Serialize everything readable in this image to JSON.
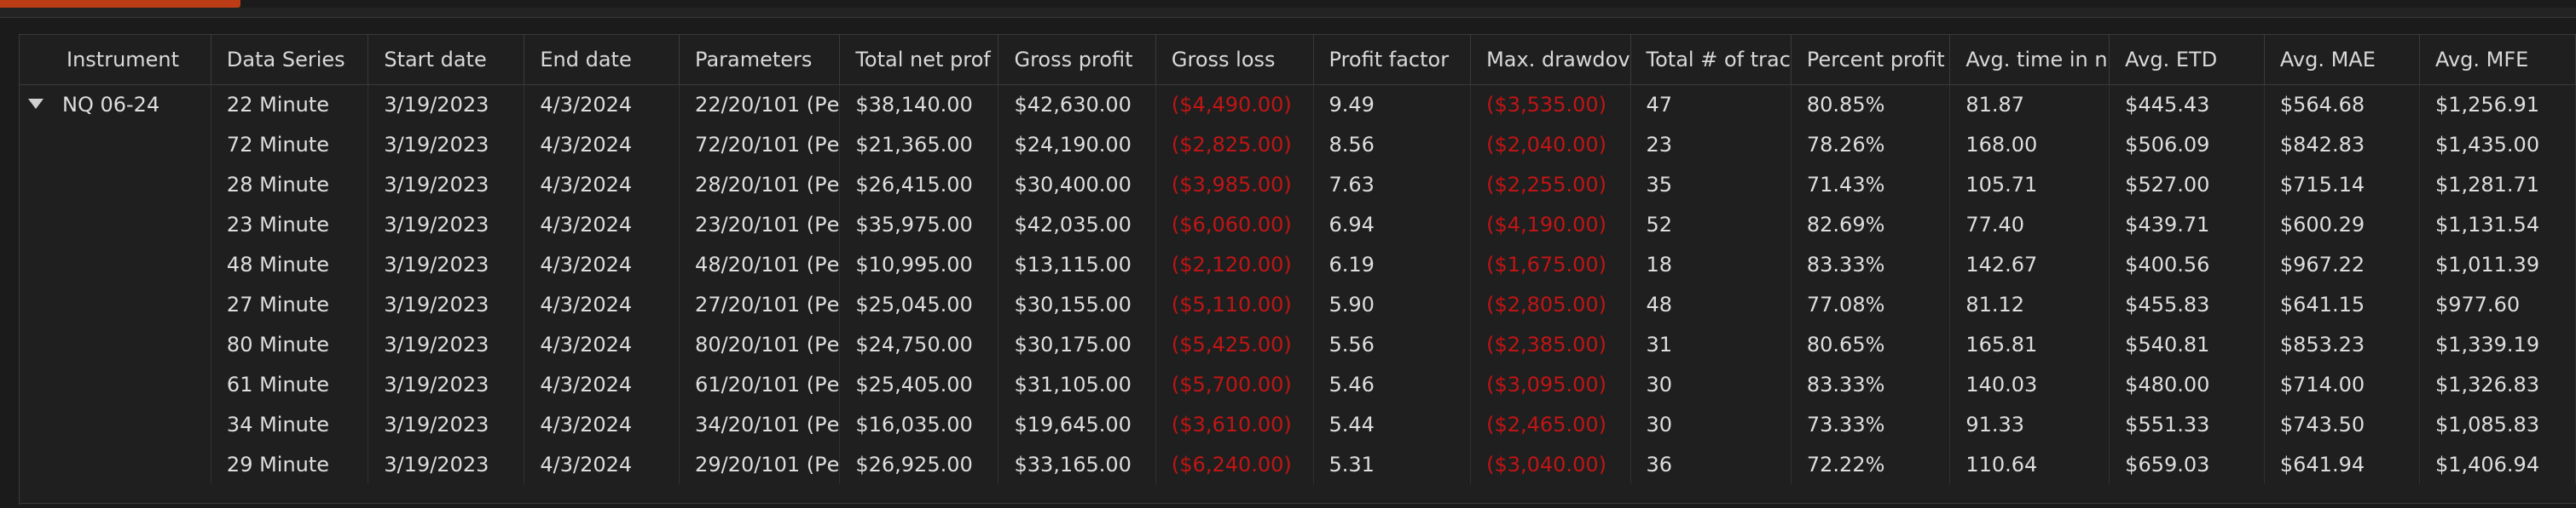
{
  "grid": {
    "columns": [
      "Instrument",
      "Data Series",
      "Start date",
      "End date",
      "Parameters",
      "Total net prof",
      "Gross profit",
      "Gross loss",
      "Profit factor",
      "Max. drawdov",
      "Total # of trac",
      "Percent profit",
      "Avg. time in n",
      "Avg. ETD",
      "Avg. MAE",
      "Avg. MFE"
    ],
    "instrument": "NQ 06-24",
    "rows": [
      [
        "22 Minute",
        "3/19/2023",
        "4/3/2024",
        "22/20/101 (Pе",
        "$38,140.00",
        "$42,630.00",
        "($4,490.00)",
        "9.49",
        "($3,535.00)",
        "47",
        "80.85%",
        "81.87",
        "$445.43",
        "$564.68",
        "$1,256.91"
      ],
      [
        "72 Minute",
        "3/19/2023",
        "4/3/2024",
        "72/20/101 (Pе",
        "$21,365.00",
        "$24,190.00",
        "($2,825.00)",
        "8.56",
        "($2,040.00)",
        "23",
        "78.26%",
        "168.00",
        "$506.09",
        "$842.83",
        "$1,435.00"
      ],
      [
        "28 Minute",
        "3/19/2023",
        "4/3/2024",
        "28/20/101 (Pе",
        "$26,415.00",
        "$30,400.00",
        "($3,985.00)",
        "7.63",
        "($2,255.00)",
        "35",
        "71.43%",
        "105.71",
        "$527.00",
        "$715.14",
        "$1,281.71"
      ],
      [
        "23 Minute",
        "3/19/2023",
        "4/3/2024",
        "23/20/101 (Pе",
        "$35,975.00",
        "$42,035.00",
        "($6,060.00)",
        "6.94",
        "($4,190.00)",
        "52",
        "82.69%",
        "77.40",
        "$439.71",
        "$600.29",
        "$1,131.54"
      ],
      [
        "48 Minute",
        "3/19/2023",
        "4/3/2024",
        "48/20/101 (Pе",
        "$10,995.00",
        "$13,115.00",
        "($2,120.00)",
        "6.19",
        "($1,675.00)",
        "18",
        "83.33%",
        "142.67",
        "$400.56",
        "$967.22",
        "$1,011.39"
      ],
      [
        "27 Minute",
        "3/19/2023",
        "4/3/2024",
        "27/20/101 (Pе",
        "$25,045.00",
        "$30,155.00",
        "($5,110.00)",
        "5.90",
        "($2,805.00)",
        "48",
        "77.08%",
        "81.12",
        "$455.83",
        "$641.15",
        "$977.60"
      ],
      [
        "80 Minute",
        "3/19/2023",
        "4/3/2024",
        "80/20/101 (Pе",
        "$24,750.00",
        "$30,175.00",
        "($5,425.00)",
        "5.56",
        "($2,385.00)",
        "31",
        "80.65%",
        "165.81",
        "$540.81",
        "$853.23",
        "$1,339.19"
      ],
      [
        "61 Minute",
        "3/19/2023",
        "4/3/2024",
        "61/20/101 (Pе",
        "$25,405.00",
        "$31,105.00",
        "($5,700.00)",
        "5.46",
        "($3,095.00)",
        "30",
        "83.33%",
        "140.03",
        "$480.00",
        "$714.00",
        "$1,326.83"
      ],
      [
        "34 Minute",
        "3/19/2023",
        "4/3/2024",
        "34/20/101 (Pе",
        "$16,035.00",
        "$19,645.00",
        "($3,610.00)",
        "5.44",
        "($2,465.00)",
        "30",
        "73.33%",
        "91.33",
        "$551.33",
        "$743.50",
        "$1,085.83"
      ],
      [
        "29 Minute",
        "3/19/2023",
        "4/3/2024",
        "29/20/101 (Pе",
        "$26,925.00",
        "$33,165.00",
        "($6,240.00)",
        "5.31",
        "($3,040.00)",
        "36",
        "72.22%",
        "110.64",
        "$659.03",
        "$641.94",
        "$1,406.94"
      ]
    ],
    "negative_color": "#c01515"
  }
}
